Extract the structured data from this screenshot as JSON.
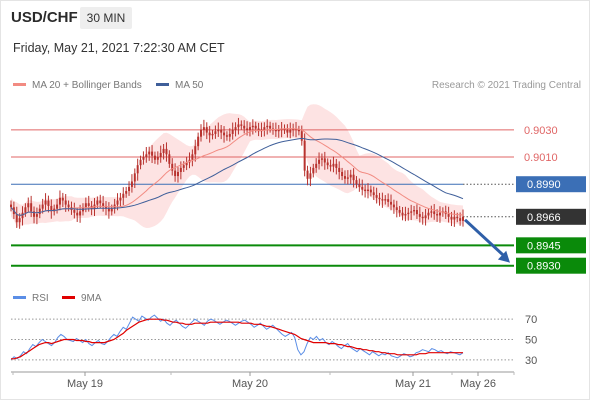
{
  "header": {
    "symbol": "USD/CHF",
    "timeframe": "30 MIN",
    "date": "Friday, May 21, 2021 7:22:30 AM CET"
  },
  "legend": {
    "ma20_label": "MA 20 + Bollinger Bands",
    "ma50_label": "MA 50",
    "credit": "Research © 2021 Trading Central",
    "rsi_label": "RSI",
    "rsi_ma_label": "9MA"
  },
  "colors": {
    "ma20": "#f28b82",
    "ma50": "#3f5f9a",
    "bollinger_fill": "#fde3e3",
    "candle": "#b8322e",
    "resistance": "#e06666",
    "pivot": "#3b6fb6",
    "support": "#0a8a0a",
    "current": "#333333",
    "rsi": "#5b8ee6",
    "rsi_ma": "#e00000"
  },
  "chart_data": [
    {
      "type": "candlestick",
      "ylim": [
        0.8918,
        0.9052
      ],
      "x_ticks": [
        "May 19",
        "May 20",
        "May 21",
        "May 26"
      ],
      "levels": [
        {
          "value": 0.903,
          "label": "0.9030",
          "kind": "resistance"
        },
        {
          "value": 0.901,
          "label": "0.9010",
          "kind": "resistance"
        },
        {
          "value": 0.899,
          "label": "0.8990",
          "kind": "pivot"
        },
        {
          "value": 0.8966,
          "label": "0.8966",
          "kind": "current"
        },
        {
          "value": 0.8945,
          "label": "0.8945",
          "kind": "support"
        },
        {
          "value": 0.893,
          "label": "0.8930",
          "kind": "support"
        }
      ],
      "close": [
        0.8973,
        0.8968,
        0.8962,
        0.8965,
        0.8969,
        0.8973,
        0.8976,
        0.897,
        0.8966,
        0.8968,
        0.8972,
        0.8975,
        0.8978,
        0.8974,
        0.897,
        0.8972,
        0.8975,
        0.898,
        0.8978,
        0.8975,
        0.8973,
        0.8971,
        0.8969,
        0.8967,
        0.897,
        0.8973,
        0.8976,
        0.8974,
        0.8972,
        0.8975,
        0.8978,
        0.8976,
        0.8974,
        0.8972,
        0.897,
        0.8972,
        0.8975,
        0.8978,
        0.898,
        0.8983,
        0.8985,
        0.8988,
        0.8992,
        0.8998,
        0.9004,
        0.9008,
        0.901,
        0.9012,
        0.9014,
        0.9011,
        0.9008,
        0.901,
        0.9013,
        0.9016,
        0.9012,
        0.9005,
        0.9,
        0.8996,
        0.8999,
        0.9002,
        0.9004,
        0.9006,
        0.9008,
        0.9012,
        0.9018,
        0.9025,
        0.903,
        0.9032,
        0.9028,
        0.9026,
        0.9027,
        0.9029,
        0.903,
        0.9028,
        0.9026,
        0.9025,
        0.9027,
        0.903,
        0.9032,
        0.9034,
        0.9033,
        0.9031,
        0.903,
        0.9032,
        0.9033,
        0.9031,
        0.9029,
        0.903,
        0.9032,
        0.9033,
        0.9031,
        0.903,
        0.9029,
        0.903,
        0.9031,
        0.903,
        0.9028,
        0.903,
        0.9031,
        0.903,
        0.9029,
        0.9022,
        0.9,
        0.8994,
        0.8998,
        0.9002,
        0.9005,
        0.9008,
        0.9009,
        0.9006,
        0.9004,
        0.9003,
        0.9005,
        0.9002,
        0.8999,
        0.8996,
        0.8994,
        0.8995,
        0.8997,
        0.8993,
        0.899,
        0.8988,
        0.8986,
        0.8985,
        0.8986,
        0.8984,
        0.8982,
        0.898,
        0.8979,
        0.8978,
        0.8979,
        0.8977,
        0.8975,
        0.8973,
        0.8971,
        0.8969,
        0.8967,
        0.8968,
        0.8969,
        0.897,
        0.8971,
        0.8968,
        0.8966,
        0.8965,
        0.8967,
        0.8969,
        0.897,
        0.8968,
        0.8967,
        0.8969,
        0.897,
        0.8968,
        0.8966,
        0.8964,
        0.8966,
        0.8965,
        0.8963,
        0.8966
      ],
      "rsi": [
        30,
        33,
        31,
        34,
        38,
        36,
        41,
        45,
        43,
        47,
        50,
        48,
        46,
        44,
        47,
        52,
        55,
        53,
        50,
        49,
        48,
        51,
        49,
        47,
        50,
        46,
        44,
        47,
        49,
        46,
        45,
        48,
        52,
        55,
        53,
        58,
        62,
        60,
        66,
        72,
        70,
        68,
        73,
        71,
        69,
        72,
        74,
        71,
        68,
        70,
        66,
        64,
        67,
        69,
        66,
        63,
        61,
        64,
        67,
        70,
        68,
        66,
        64,
        68,
        70,
        69,
        67,
        65,
        67,
        69,
        68,
        66,
        64,
        66,
        68,
        69,
        67,
        65,
        62,
        64,
        66,
        63,
        60,
        62,
        64,
        61,
        58,
        55,
        53,
        55,
        57,
        52,
        40,
        35,
        38,
        46,
        52,
        50,
        53,
        49,
        51,
        47,
        45,
        48,
        46,
        43,
        41,
        44,
        46,
        42,
        40,
        38,
        41,
        39,
        37,
        35,
        38,
        36,
        34,
        36,
        35,
        37,
        34,
        33,
        32,
        34,
        36,
        35,
        33,
        34,
        37,
        38,
        40,
        39,
        38,
        41,
        40,
        38,
        39,
        37,
        36,
        38,
        37,
        36,
        35,
        37
      ],
      "rsi_ma": [
        31,
        31,
        32,
        33,
        35,
        37,
        39,
        41,
        43,
        45,
        46,
        47,
        47,
        46,
        47,
        48,
        49,
        50,
        50,
        50,
        50,
        49,
        49,
        49,
        48,
        48,
        47,
        47,
        47,
        47,
        47,
        48,
        49,
        50,
        52,
        54,
        56,
        59,
        61,
        63,
        65,
        67,
        68,
        69,
        70,
        70,
        70,
        70,
        70,
        69,
        69,
        68,
        67,
        67,
        66,
        66,
        65,
        65,
        65,
        66,
        66,
        66,
        66,
        66,
        67,
        67,
        67,
        67,
        67,
        67,
        67,
        67,
        67,
        67,
        66,
        66,
        66,
        66,
        65,
        65,
        65,
        64,
        63,
        63,
        62,
        61,
        60,
        59,
        58,
        57,
        56,
        55,
        53,
        51,
        50,
        49,
        48,
        47,
        47,
        47,
        47,
        47,
        46,
        46,
        46,
        45,
        45,
        44,
        43,
        43,
        42,
        41,
        41,
        40,
        40,
        39,
        39,
        38,
        38,
        37,
        37,
        36,
        36,
        36,
        35,
        35,
        35,
        35,
        35,
        35,
        35,
        36,
        36,
        36,
        37,
        37,
        37,
        37,
        37,
        37,
        37,
        37,
        37,
        37,
        37,
        37
      ],
      "rsi_ticks": [
        "70",
        "50",
        "30"
      ],
      "series": [
        {
          "name": "MA 20 + Bollinger Bands"
        },
        {
          "name": "MA 50"
        },
        {
          "name": "RSI"
        },
        {
          "name": "9MA"
        }
      ]
    }
  ]
}
